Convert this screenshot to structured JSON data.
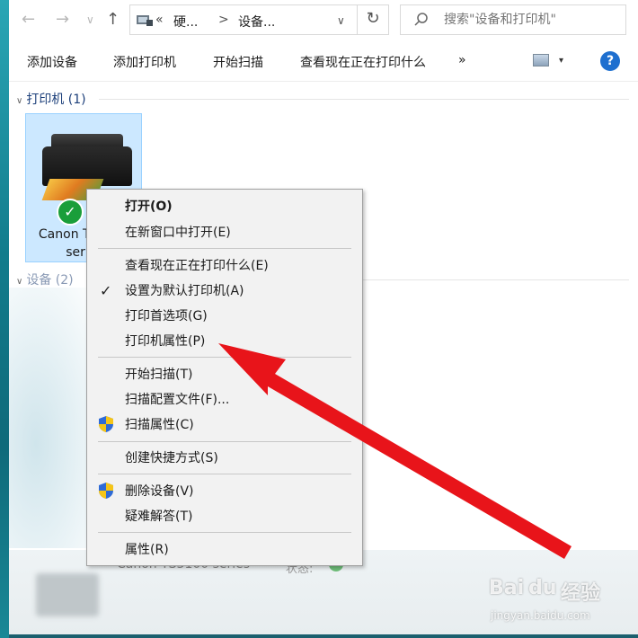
{
  "address_bar": {
    "back_glyph": "←",
    "forward_glyph": "→",
    "dropdown_glyph": "∨",
    "up_glyph": "↑",
    "overflow_glyph": "«",
    "crumbs": [
      "硬...",
      "设备..."
    ],
    "sep_glyph": ">",
    "refresh_glyph": "↻",
    "search_placeholder": "搜索\"设备和打印机\""
  },
  "toolbar": {
    "items": [
      "添加设备",
      "添加打印机",
      "开始扫描",
      "查看现在正在打印什么"
    ],
    "more_glyph": "»",
    "view_caret": "▾",
    "help_label": "?"
  },
  "groups": {
    "printers_header": "打印机 (1)",
    "devices_header": "设备 (2)",
    "collapse_glyph": "∨"
  },
  "device": {
    "label": "Canon TS3100 series",
    "check_glyph": "✓"
  },
  "details": {
    "name": "Canon TS3100 series",
    "status_label": "状态:"
  },
  "context_menu": {
    "items": [
      {
        "label": "打开(O)",
        "bold": true
      },
      {
        "label": "在新窗口中打开(E)"
      },
      {
        "label": "查看现在正在打印什么(E)"
      },
      {
        "label": "设置为默认打印机(A)",
        "checked": true
      },
      {
        "label": "打印首选项(G)"
      },
      {
        "label": "打印机属性(P)"
      },
      {
        "label": "开始扫描(T)"
      },
      {
        "label": "扫描配置文件(F)..."
      },
      {
        "label": "扫描属性(C)",
        "shield": true
      },
      {
        "label": "创建快捷方式(S)"
      },
      {
        "label": "删除设备(V)",
        "shield": true
      },
      {
        "label": "疑难解答(T)"
      },
      {
        "label": "属性(R)"
      }
    ],
    "check_glyph": "✓"
  },
  "annotation": {
    "arrow_color": "#e8141a"
  },
  "watermark": {
    "brand": "Bai",
    "paw": "du",
    "suffix": "经验",
    "url": "jingyan.baidu.com"
  }
}
